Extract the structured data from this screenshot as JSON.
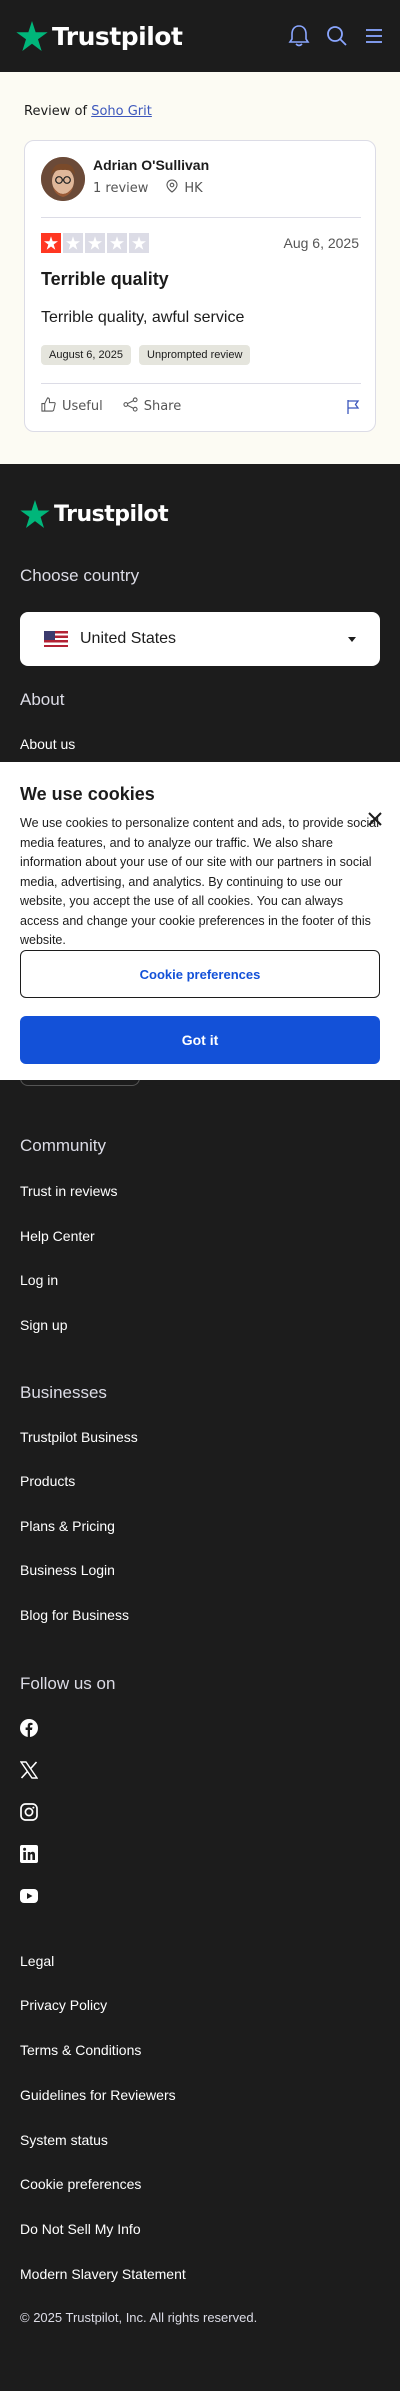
{
  "brand": {
    "name": "Trustpilot",
    "star_color": "#00b67a"
  },
  "header": {
    "icons": [
      "bell-icon",
      "search-icon",
      "menu-icon"
    ]
  },
  "review": {
    "review_of_prefix": "Review of",
    "business_name": "Soho Grit",
    "reviewer_name": "Adrian O'Sullivan",
    "review_count": "1 review",
    "location": "HK",
    "rating": 1,
    "rating_max": 5,
    "date": "Aug 6, 2025",
    "title": "Terrible quality",
    "text": "Terrible quality, awful service",
    "tags": [
      "August 6, 2025",
      "Unprompted review"
    ],
    "useful_label": "Useful",
    "share_label": "Share"
  },
  "footer": {
    "choose_country_heading": "Choose country",
    "country": "United States",
    "about_heading": "About",
    "about_link": "About us",
    "community_heading": "Community",
    "community_links": [
      "Trust in reviews",
      "Help Center",
      "Log in",
      "Sign up"
    ],
    "businesses_heading": "Businesses",
    "business_links": [
      "Trustpilot Business",
      "Products",
      "Plans & Pricing",
      "Business Login",
      "Blog for Business"
    ],
    "follow_heading": "Follow us on",
    "social_icons": [
      "facebook-icon",
      "x-icon",
      "instagram-icon",
      "linkedin-icon",
      "youtube-icon"
    ],
    "legal_links": [
      "Legal",
      "Privacy Policy",
      "Terms & Conditions",
      "Guidelines for Reviewers",
      "System status",
      "Cookie preferences",
      "Do Not Sell My Info",
      "Modern Slavery Statement"
    ],
    "copyright": "© 2025 Trustpilot, Inc. All rights reserved."
  },
  "cookie_banner": {
    "title": "We use cookies",
    "text": "We use cookies to personalize content and ads, to provide social media features, and to analyze our traffic. We also share information about your use of our site with our partners in social media, advertising, and analytics. By continuing to use our website, you accept the use of all cookies. You can always access and change your cookie preferences in the footer of this website.",
    "preferences_label": "Cookie preferences",
    "accept_label": "Got it",
    "accent_color": "#1351d8"
  }
}
